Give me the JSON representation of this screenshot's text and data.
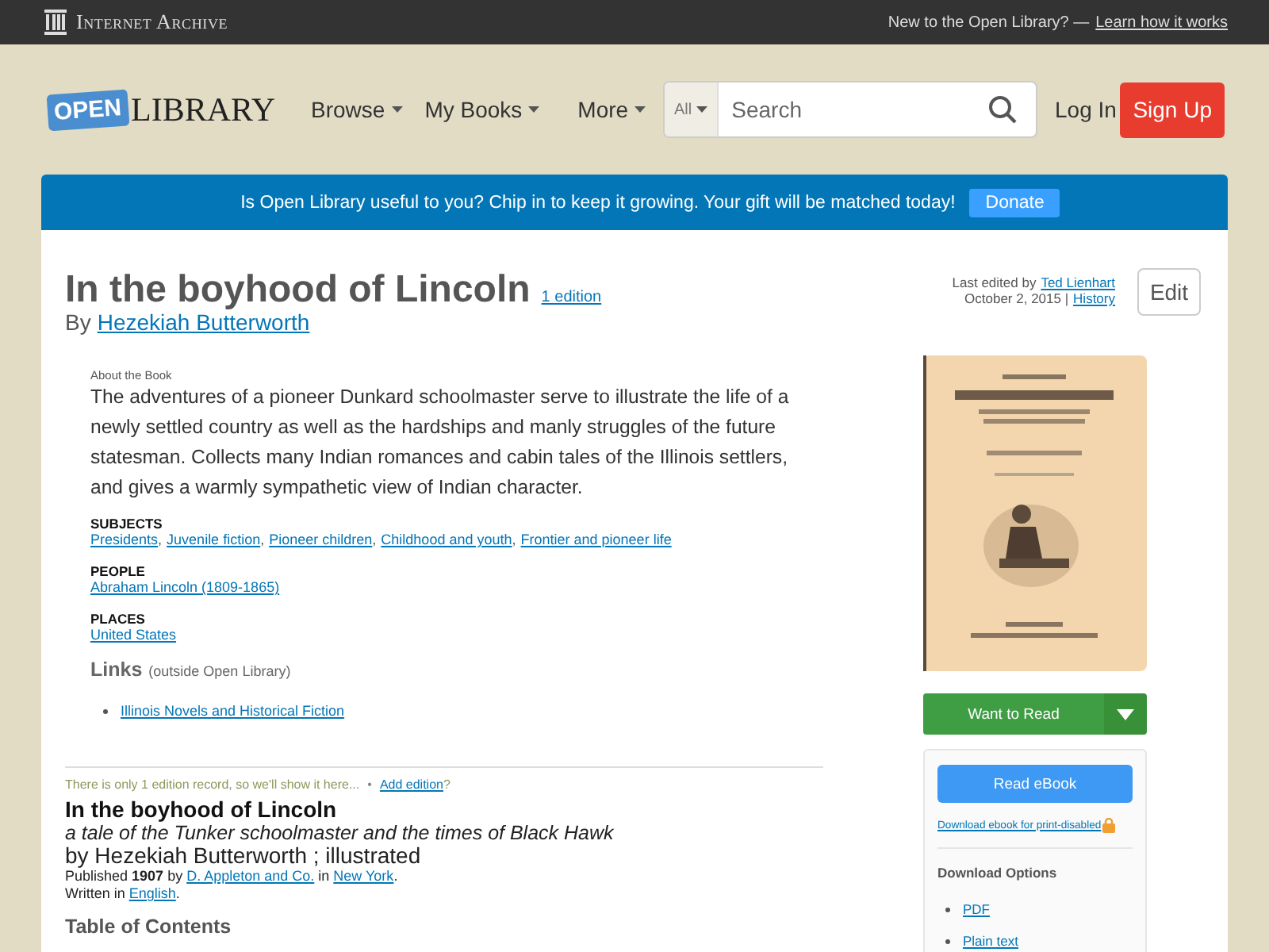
{
  "top_bar": {
    "brand": "Internet Archive",
    "prompt": "New to the Open Library? —",
    "link": "Learn how it works"
  },
  "header": {
    "logo_badge": "OPEN",
    "logo_text": "LIBRARY",
    "nav": [
      {
        "label": "Browse"
      },
      {
        "label": "My Books"
      },
      {
        "label": "More"
      }
    ],
    "search": {
      "scope": "All",
      "placeholder": "Search"
    },
    "login": "Log In",
    "signup": "Sign Up"
  },
  "banner": {
    "message": "Is Open Library useful to you? Chip in to keep it growing. Your gift will be matched today!",
    "button": "Donate"
  },
  "work": {
    "title": "In the boyhood of Lincoln",
    "editions_link": "1 edition",
    "by": "By",
    "author": "Hezekiah Butterworth",
    "about_label": "About the Book",
    "description": "The adventures of a pioneer Dunkard schoolmaster serve to illustrate the life of a newly settled country as well as the hardships and manly struggles of the future statesman. Collects many Indian romances and cabin tales of the Illinois settlers, and gives a warmly sympathetic view of Indian character.",
    "facets": [
      {
        "heading": "SUBJECTS",
        "separator": ",",
        "items": [
          "Presidents",
          "Juvenile fiction",
          "Pioneer children",
          "Childhood and youth",
          "Frontier and pioneer life"
        ]
      },
      {
        "heading": "PEOPLE",
        "items": [
          "Abraham Lincoln (1809-1865)"
        ]
      },
      {
        "heading": "PLACES",
        "items": [
          "United States"
        ]
      }
    ],
    "links_heading": "Links",
    "links_note": "(outside Open Library)",
    "links": [
      "Illinois Novels and Historical Fiction"
    ]
  },
  "edit_info": {
    "prefix": "Last edited by",
    "editor": "Ted Lienhart",
    "date": "October 2, 2015 |",
    "history": "History",
    "edit_button": "Edit"
  },
  "actions": {
    "want_to_read": "Want to Read",
    "read_ebook": "Read eBook",
    "print_disabled": "Download ebook for print-disabled",
    "download_heading": "Download Options",
    "downloads": [
      "PDF",
      "Plain text"
    ]
  },
  "edition": {
    "notice": "There is only 1 edition record, so we'll show it here...",
    "separator": "•",
    "add_link": "Add edition",
    "add_suffix": "?",
    "title": "In the boyhood of Lincoln",
    "subtitle": "a tale of the Tunker schoolmaster and the times of Black Hawk",
    "byline": "by Hezekiah Butterworth ; illustrated",
    "published": "Published **1907** by",
    "publisher": "D. Appleton and Co.",
    "in": "in",
    "place": "New York",
    "end": ".",
    "written": "Written in",
    "language": "English",
    "end2": "."
  },
  "toc_heading": "Table of Contents"
}
